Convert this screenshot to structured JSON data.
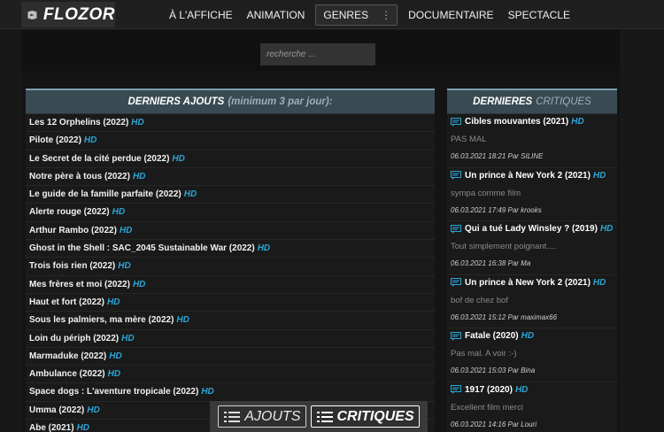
{
  "brand": {
    "name": "FLOZOR",
    "icon": "film-logo-icon"
  },
  "nav": {
    "items": [
      "À L'AFFICHE",
      "ANIMATION",
      "GENRES",
      "DOCUMENTAIRE",
      "SPECTACLE"
    ],
    "genres_menu_icon": "vertical-dots-icon"
  },
  "search": {
    "placeholder": "recherche ..."
  },
  "latest": {
    "title": "DERNIERS AJOUTS",
    "subtitle": "(minimum 3 par jour):",
    "items": [
      {
        "title": "Les 12 Orphelins (2022)",
        "badge": "HD"
      },
      {
        "title": "Pilote (2022)",
        "badge": "HD"
      },
      {
        "title": "Le Secret de la cité perdue (2022)",
        "badge": "HD"
      },
      {
        "title": "Notre père à tous (2022)",
        "badge": "HD"
      },
      {
        "title": "Le guide de la famille parfaite (2022)",
        "badge": "HD"
      },
      {
        "title": "Alerte rouge (2022)",
        "badge": "HD"
      },
      {
        "title": "Arthur Rambo (2022)",
        "badge": "HD"
      },
      {
        "title": "Ghost in the Shell : SAC_2045 Sustainable War (2022)",
        "badge": "HD"
      },
      {
        "title": "Trois fois rien (2022)",
        "badge": "HD"
      },
      {
        "title": "Mes frères et moi (2022)",
        "badge": "HD"
      },
      {
        "title": "Haut et fort (2022)",
        "badge": "HD"
      },
      {
        "title": "Sous les palmiers, ma mère (2022)",
        "badge": "HD"
      },
      {
        "title": "Loin du périph (2022)",
        "badge": "HD"
      },
      {
        "title": "Marmaduke (2022)",
        "badge": "HD"
      },
      {
        "title": "Ambulance (2022)",
        "badge": "HD"
      },
      {
        "title": "Space dogs : L'aventure tropicale (2022)",
        "badge": "HD"
      },
      {
        "title": "Umma (2022)",
        "badge": "HD"
      },
      {
        "title": "Abe (2021)",
        "badge": "HD"
      }
    ]
  },
  "critiques": {
    "title": "DERNIERES",
    "title_muted": "CRITIQUES",
    "items": [
      {
        "title": "Cibles mouvantes (2021)",
        "badge": "HD",
        "text": "PAS MAL",
        "meta": "06.03.2021 18:21 Par SILINE"
      },
      {
        "title": "Un prince à New York 2 (2021)",
        "badge": "HD",
        "text": "sympa comme film",
        "meta": "06.03.2021 17:49 Par krooks"
      },
      {
        "title": "Qui a tué Lady Winsley ? (2019)",
        "badge": "HD",
        "text": "Tout simplement poignant....",
        "meta": "06.03.2021 16:38 Par Ma"
      },
      {
        "title": "Un prince à New York 2 (2021)",
        "badge": "HD",
        "text": "bof de chez bof",
        "meta": "06.03.2021 15:12 Par maximax66"
      },
      {
        "title": "Fatale (2020)",
        "badge": "HD",
        "text": "Pas mal. A voir :-)",
        "meta": "06.03.2021 15:03 Par Bina"
      },
      {
        "title": "1917 (2020)",
        "badge": "HD",
        "text": "Excellent film merci",
        "meta": "06.03.2021 14:16 Par Louri"
      }
    ]
  },
  "switcher": {
    "ajouts": "AJOUTS",
    "critiques": "CRITIQUES",
    "icon": "list-icon"
  },
  "colors": {
    "accent": "#2aa6d6",
    "panel_header": "#3a4a52"
  }
}
